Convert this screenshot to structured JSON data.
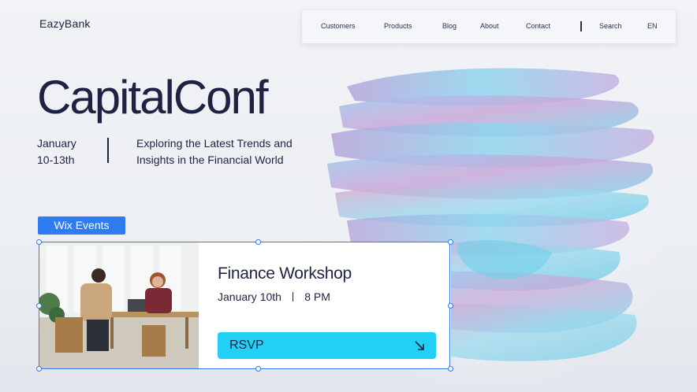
{
  "brand": "EazyBank",
  "nav": {
    "items": [
      "Customers",
      "Products",
      "Blog",
      "About",
      "Contact"
    ],
    "search": "Search",
    "lang": "EN"
  },
  "hero": {
    "title": "CapitalConf",
    "date_line1": "January",
    "date_line2": "10-13th",
    "tagline_line1": "Exploring the Latest Trends and",
    "tagline_line2": "Insights in the Financial World"
  },
  "editor": {
    "badge": "Wix Events"
  },
  "event_card": {
    "title": "Finance Workshop",
    "date": "January 10th",
    "time": "8 PM",
    "button": "RSVP"
  },
  "colors": {
    "accent_blue": "#2f7cf0",
    "rsvp_cyan": "#22d0f5",
    "text_navy": "#1e2344"
  }
}
